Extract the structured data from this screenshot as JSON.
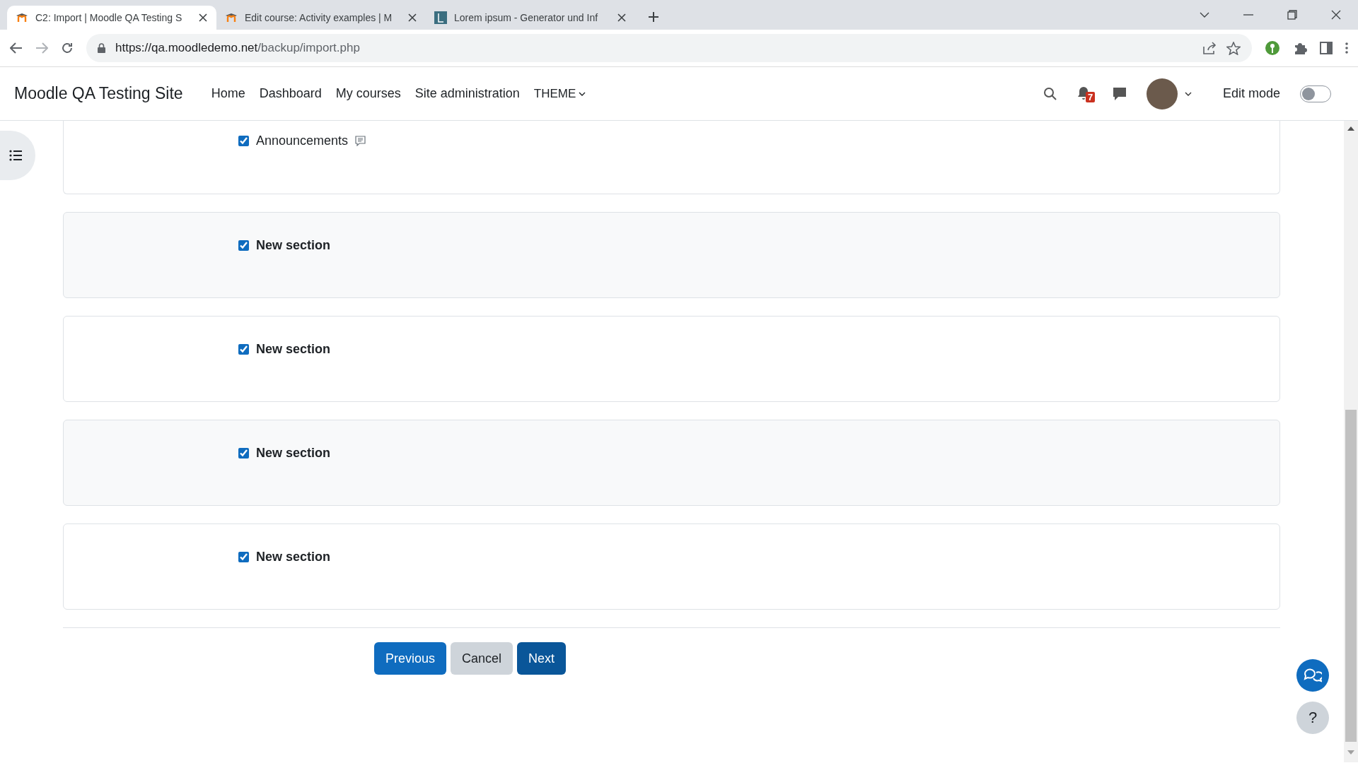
{
  "browser": {
    "tabs": [
      {
        "title": "C2: Import | Moodle QA Testing S",
        "selected": true,
        "kind": "moodle"
      },
      {
        "title": "Edit course: Activity examples | M",
        "selected": false,
        "kind": "moodle"
      },
      {
        "title": "Lorem ipsum - Generator und Inf",
        "selected": false,
        "kind": "letter"
      }
    ],
    "url_host": "https://qa.moodledemo.net",
    "url_path": "/backup/import.php"
  },
  "navbar": {
    "site_name": "Moodle QA Testing Site",
    "links": [
      "Home",
      "Dashboard",
      "My courses",
      "Site administration"
    ],
    "theme_menu": "THEME",
    "notification_count": "7",
    "edit_mode_label": "Edit mode",
    "edit_mode_on": false
  },
  "sections": [
    {
      "kind": "activity",
      "label": "Announcements",
      "checked": true
    },
    {
      "kind": "section",
      "label": "New section",
      "checked": true
    },
    {
      "kind": "section",
      "label": "New section",
      "checked": true
    },
    {
      "kind": "section",
      "label": "New section",
      "checked": true
    },
    {
      "kind": "section",
      "label": "New section",
      "checked": true
    }
  ],
  "buttons": [
    {
      "label": "Previous",
      "kind": "primary"
    },
    {
      "label": "Cancel",
      "kind": "secondary"
    },
    {
      "label": "Next",
      "kind": "submit"
    }
  ],
  "help_button": "?"
}
